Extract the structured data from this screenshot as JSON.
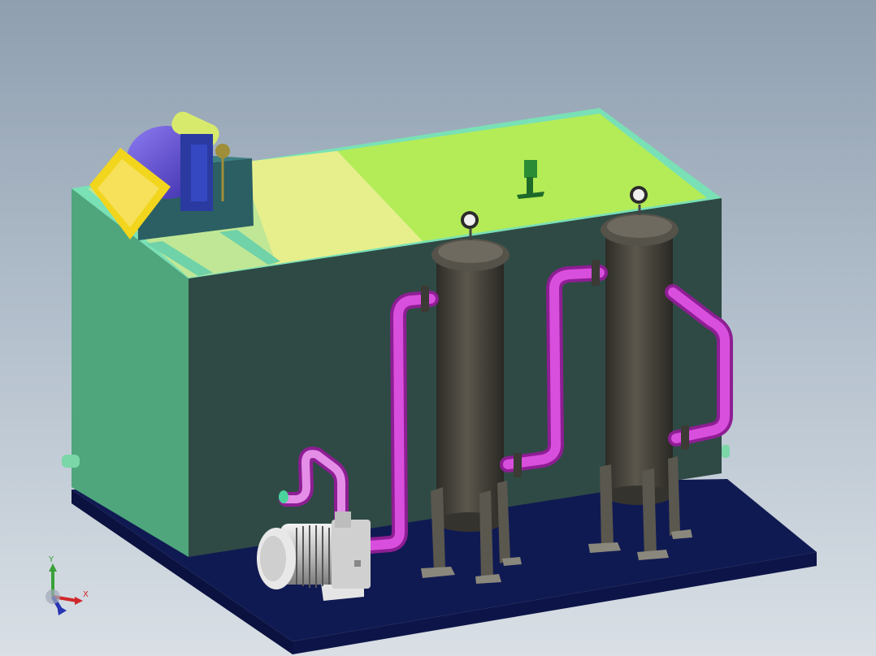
{
  "viewport": {
    "background_top": "#8f9fb0",
    "background_bottom": "#d9dfe5"
  },
  "model": {
    "tank_color": "#3f6a56",
    "tank_side_color": "#4fa67c",
    "lid_yellow": "#e7ef8c",
    "lid_green": "#b4ec57",
    "filter_color": "#4a4740",
    "pipe_color": "#c53fc9",
    "base_color": "#101a52",
    "motor_color": "#d9d9d9"
  },
  "triad": {
    "x_label": "X",
    "y_label": "Y",
    "x_color": "#d0282a",
    "y_color": "#3aa13a",
    "z_color": "#2735b3"
  }
}
